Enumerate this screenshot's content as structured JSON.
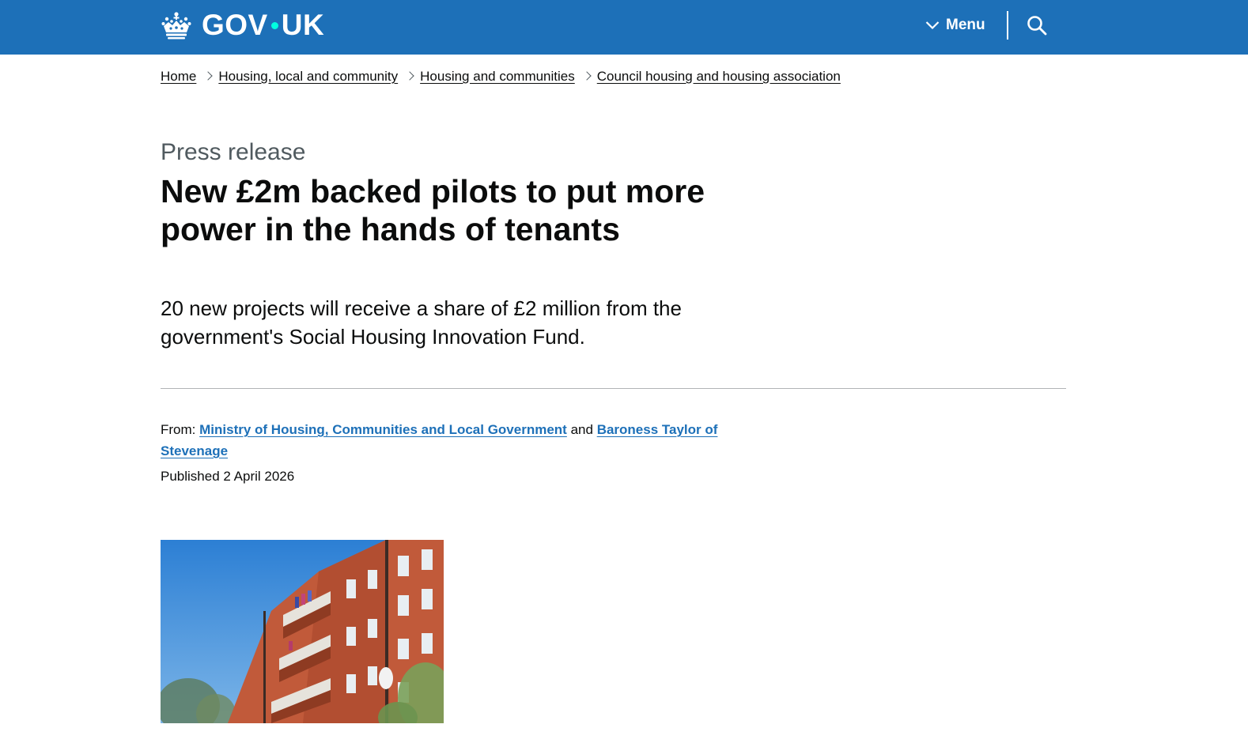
{
  "header": {
    "logo_text_left": "GOV",
    "logo_text_right": "UK",
    "menu_label": "Menu",
    "brand_color": "#1d70b8",
    "dot_color": "#00ffe0",
    "icons": [
      "crown-icon",
      "chevron-down-icon",
      "search-icon"
    ]
  },
  "breadcrumbs": [
    {
      "label": "Home"
    },
    {
      "label": "Housing, local and community"
    },
    {
      "label": "Housing and communities"
    },
    {
      "label": "Council housing and housing association"
    }
  ],
  "article": {
    "caption": "Press release",
    "title": "New £2m backed pilots to put more power in the hands of tenants",
    "lead": "20 new projects will receive a share of £2 million from the government's Social Housing Innovation Fund.",
    "from_label": "From:",
    "from_org_1": "Ministry of Housing, Communities and Local Government",
    "from_and": "and",
    "from_org_2": "Baroness Taylor of Stevenage",
    "published_label": "Published",
    "published_date": "2 April 2026"
  }
}
